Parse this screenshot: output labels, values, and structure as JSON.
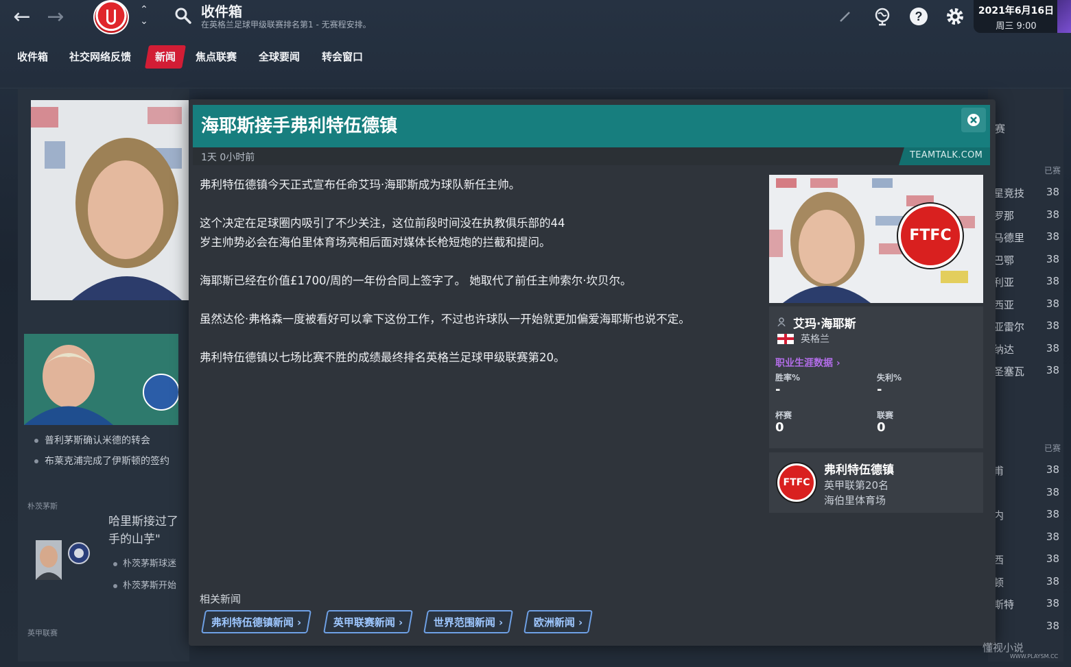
{
  "header": {
    "title": "收件箱",
    "subtitle": "在英格兰足球甲级联赛排名第1 - 无赛程安排。",
    "date": "2021年6月16日",
    "weekday_time": "周三 9:00"
  },
  "tabs": [
    {
      "label": "收件箱"
    },
    {
      "label": "社交网络反馈"
    },
    {
      "label": "新闻",
      "active": true
    },
    {
      "label": "焦点联赛"
    },
    {
      "label": "全球要闻"
    },
    {
      "label": "转会窗口"
    }
  ],
  "left_panel": {
    "item1": "普利茅斯确认米德的转会",
    "item2": "布莱克浦完成了伊斯顿的签约",
    "section1": "朴茨茅斯",
    "headline": "哈里斯接过了手的山芋\"",
    "sub1": "朴茨茅斯球迷",
    "sub2": "朴茨茅斯开始",
    "section2": "英甲联赛"
  },
  "right_panel": {
    "header1": "赛",
    "col1": "已赛",
    "col2": "已赛",
    "rows_top": [
      {
        "name": "星竞技",
        "played": "38"
      },
      {
        "name": "罗那",
        "played": "38"
      },
      {
        "name": "马德里",
        "played": "38"
      },
      {
        "name": "巴鄂",
        "played": "38"
      },
      {
        "name": "利亚",
        "played": "38"
      },
      {
        "name": "西亚",
        "played": "38"
      },
      {
        "name": "亚雷尔",
        "played": "38"
      },
      {
        "name": "纳达",
        "played": "38"
      },
      {
        "name": "圣塞瓦",
        "played": "38"
      }
    ],
    "rows_bottom": [
      {
        "name": "甫",
        "played": "38"
      },
      {
        "name": "",
        "played": "38"
      },
      {
        "name": "内",
        "played": "38"
      },
      {
        "name": "",
        "played": "38"
      },
      {
        "name": "西",
        "played": "38"
      },
      {
        "name": "顿",
        "played": "38"
      },
      {
        "name": "斯特",
        "played": "38"
      },
      {
        "name": "",
        "played": "38"
      }
    ]
  },
  "article": {
    "title": "海耶斯接手弗利特伍德镇",
    "timestamp": "1天 0小时前",
    "source": "TEAMTALK.COM",
    "paragraphs": [
      "弗利特伍德镇今天正式宣布任命艾玛·海耶斯成为球队新任主帅。",
      "这个决定在足球圈内吸引了不少关注，这位前段时间没在执教俱乐部的44\n岁主帅势必会在海伯里体育场亮相后面对媒体长枪短炮的拦截和提问。",
      "海耶斯已经在价值£1700/周的一年份合同上签字了。 她取代了前任主帅索尔·坎贝尔。",
      "虽然达伦·弗格森一度被看好可以拿下这份工作，不过也许球队一开始就更加偏爱海耶斯也说不定。",
      "弗利特伍德镇以七场比赛不胜的成绩最终排名英格兰足球甲级联赛第20。"
    ],
    "related_label": "相关新闻",
    "related": [
      "弗利特伍德镇新闻 ›",
      "英甲联赛新闻 ›",
      "世界范围新闻 ›",
      "欧洲新闻 ›"
    ]
  },
  "person": {
    "name": "艾玛·海耶斯",
    "nation": "英格兰",
    "career_link": "职业生涯数据 ›",
    "win_label": "胜率%",
    "win_value": "-",
    "loss_label": "失利%",
    "loss_value": "-",
    "cup_label": "杯赛",
    "cup_value": "0",
    "league_label": "联赛",
    "league_value": "0"
  },
  "club": {
    "badge_text": "FTFC",
    "name": "弗利特伍德镇",
    "position": "英甲联第20名",
    "stadium": "海伯里体育场"
  },
  "watermark": {
    "main": "懂视小说",
    "url": "WWW.PLAYSM.CC"
  },
  "colors": {
    "header_teal": "#177e7e",
    "active_tab": "#d21d35",
    "link_purple": "#b26de8",
    "button_blue": "#9ec7ff"
  }
}
